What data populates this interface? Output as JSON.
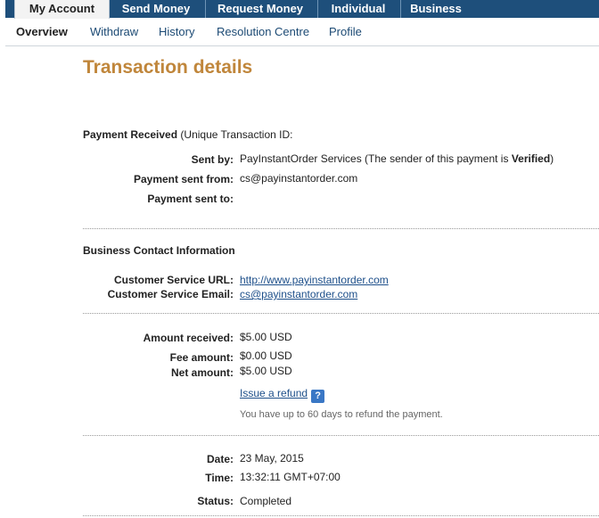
{
  "tabs": [
    {
      "label": "My Account",
      "active": true
    },
    {
      "label": "Send Money"
    },
    {
      "label": "Request Money"
    },
    {
      "label": "Individual"
    },
    {
      "label": "Business"
    }
  ],
  "subnav": [
    {
      "label": "Overview",
      "active": true
    },
    {
      "label": "Withdraw"
    },
    {
      "label": "History"
    },
    {
      "label": "Resolution Centre"
    },
    {
      "label": "Profile"
    }
  ],
  "page_title": "Transaction details",
  "payment": {
    "heading_bold": "Payment Received",
    "heading_rest": "(Unique Transaction ID:",
    "sent_by_label": "Sent by:",
    "sent_by_value_pre": "PayInstantOrder Services (The sender of this payment is ",
    "sent_by_value_bold": "Verified",
    "sent_by_value_post": ")",
    "sent_from_label": "Payment sent from:",
    "sent_from_value": "cs@payinstantorder.com",
    "sent_to_label": "Payment sent to:"
  },
  "business": {
    "heading": "Business Contact Information",
    "url_label": "Customer Service URL:",
    "url_value": "http://www.payinstantorder.com",
    "email_label": "Customer Service Email:",
    "email_value": "cs@payinstantorder.com"
  },
  "amounts": {
    "received_label": "Amount received:",
    "received_value": "$5.00 USD",
    "fee_label": "Fee amount:",
    "fee_value": "$0.00 USD",
    "net_label": "Net amount:",
    "net_value": "$5.00 USD",
    "refund_link": "Issue a refund",
    "help_glyph": "?",
    "refund_note": "You have up to 60 days to refund the payment."
  },
  "datetime": {
    "date_label": "Date:",
    "date_value": "23 May, 2015",
    "time_label": "Time:",
    "time_value": "13:32:11 GMT+07:00",
    "status_label": "Status:",
    "status_value": "Completed"
  }
}
